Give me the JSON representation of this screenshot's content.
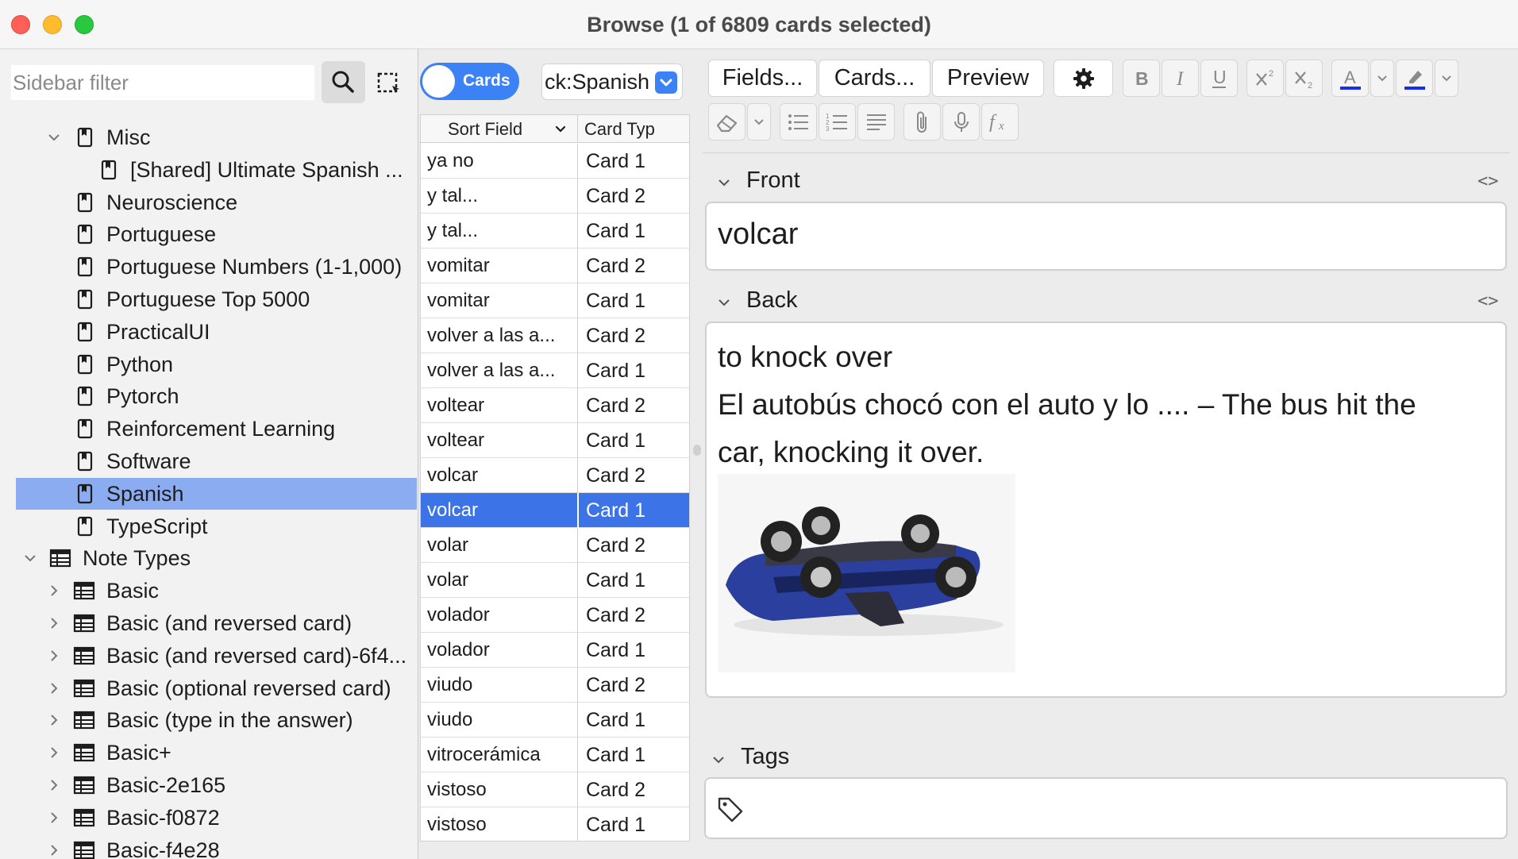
{
  "window": {
    "title": "Browse (1 of 6809 cards selected)"
  },
  "sidebar": {
    "filter_placeholder": "Sidebar filter",
    "items": [
      {
        "label": "Misc",
        "type": "deck",
        "indent": 1,
        "expanded": true
      },
      {
        "label": "[Shared] Ultimate Spanish ...",
        "type": "deck",
        "indent": 2
      },
      {
        "label": "Neuroscience",
        "type": "deck",
        "indent": 1
      },
      {
        "label": "Portuguese",
        "type": "deck",
        "indent": 1
      },
      {
        "label": "Portuguese Numbers (1-1,000)",
        "type": "deck",
        "indent": 1
      },
      {
        "label": "Portuguese Top 5000",
        "type": "deck",
        "indent": 1
      },
      {
        "label": "PracticalUI",
        "type": "deck",
        "indent": 1
      },
      {
        "label": "Python",
        "type": "deck",
        "indent": 1
      },
      {
        "label": "Pytorch",
        "type": "deck",
        "indent": 1
      },
      {
        "label": "Reinforcement Learning",
        "type": "deck",
        "indent": 1
      },
      {
        "label": "Software",
        "type": "deck",
        "indent": 1
      },
      {
        "label": "Spanish",
        "type": "deck",
        "indent": 1,
        "selected": true
      },
      {
        "label": "TypeScript",
        "type": "deck",
        "indent": 1
      },
      {
        "label": "Note Types",
        "type": "notetype-root",
        "indent": 0,
        "expanded": true
      },
      {
        "label": "Basic",
        "type": "notetype",
        "indent": 1
      },
      {
        "label": "Basic (and reversed card)",
        "type": "notetype",
        "indent": 1
      },
      {
        "label": "Basic (and reversed card)-6f4...",
        "type": "notetype",
        "indent": 1
      },
      {
        "label": "Basic (optional reversed card)",
        "type": "notetype",
        "indent": 1
      },
      {
        "label": "Basic (type in the answer)",
        "type": "notetype",
        "indent": 1
      },
      {
        "label": "Basic+",
        "type": "notetype",
        "indent": 1
      },
      {
        "label": "Basic-2e165",
        "type": "notetype",
        "indent": 1
      },
      {
        "label": "Basic-f0872",
        "type": "notetype",
        "indent": 1
      },
      {
        "label": "Basic-f4e28",
        "type": "notetype",
        "indent": 1
      }
    ]
  },
  "toolbar": {
    "toggle_label": "Cards",
    "deck_query": "ck:Spanish"
  },
  "table": {
    "columns": [
      "Sort Field",
      "Card Typ"
    ],
    "rows": [
      {
        "sort": "ya no",
        "card": "Card 1"
      },
      {
        "sort": "y tal...",
        "card": "Card 2"
      },
      {
        "sort": "y tal...",
        "card": "Card 1"
      },
      {
        "sort": "vomitar",
        "card": "Card 2"
      },
      {
        "sort": "vomitar",
        "card": "Card 1"
      },
      {
        "sort": "volver a las a...",
        "card": "Card 2"
      },
      {
        "sort": "volver a las a...",
        "card": "Card 1"
      },
      {
        "sort": "voltear",
        "card": "Card 2"
      },
      {
        "sort": "voltear",
        "card": "Card 1"
      },
      {
        "sort": "volcar",
        "card": "Card 2"
      },
      {
        "sort": "volcar",
        "card": "Card 1",
        "selected": true
      },
      {
        "sort": "volar",
        "card": "Card 2"
      },
      {
        "sort": "volar",
        "card": "Card 1"
      },
      {
        "sort": "volador",
        "card": "Card 2"
      },
      {
        "sort": "volador",
        "card": "Card 1"
      },
      {
        "sort": "viudo",
        "card": "Card 2"
      },
      {
        "sort": "viudo",
        "card": "Card 1"
      },
      {
        "sort": "vitrocerámica",
        "card": "Card 1"
      },
      {
        "sort": "vistoso",
        "card": "Card 2"
      },
      {
        "sort": "vistoso",
        "card": "Card 1"
      }
    ]
  },
  "editor": {
    "fields_button": "Fields...",
    "cards_button": "Cards...",
    "preview_button": "Preview",
    "front_label": "Front",
    "front_value": "volcar",
    "back_label": "Back",
    "back_lines": [
      "to knock over",
      "El autobús chocó con el auto y lo .... – The bus hit the",
      "car, knocking it over."
    ],
    "back_image": "overturned-toy-car-image",
    "tags_label": "Tags",
    "code_toggle": "<>"
  },
  "colors": {
    "accent": "#3b82f6",
    "selected_row": "#3c73e6",
    "sidebar_selected": "#8bacf0",
    "text_color_underline": "#1a2ee8"
  }
}
